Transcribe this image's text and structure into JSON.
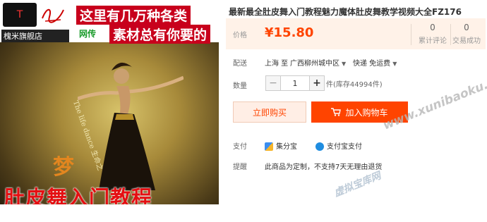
{
  "product_image": {
    "shop_logo_text": "T",
    "shop_name": "槐米旗舰店",
    "promo_line1": "这里有几万种各类",
    "promo_line2": "素材总有你要的",
    "promo_web": "网传",
    "vertical_text": "The life dance 生命之",
    "dream_char": "梦",
    "bottom_caption": "肚皮舞入门教程"
  },
  "product": {
    "title": "最新最全肚皮舞入门教程魅力魔体肚皮舞教学视频大全FZ176",
    "price_label": "价格",
    "price": "¥15.80",
    "reviews_count": "0",
    "reviews_label": "累计评论",
    "sales_count": "0",
    "sales_label": "交易成功"
  },
  "delivery": {
    "label": "配送",
    "from": "上海 至",
    "destination": "广西柳州城中区",
    "shipping": "快递 免运费"
  },
  "quantity": {
    "label": "数量",
    "value": "1",
    "minus": "−",
    "plus": "+",
    "stock": "件(库存44994件)"
  },
  "actions": {
    "buy_now": "立即购买",
    "add_to_cart": "加入购物车"
  },
  "payment": {
    "label": "支付",
    "method1": "集分宝",
    "method2": "支付宝支付"
  },
  "notice": {
    "label": "提醒",
    "text": "此商品为定制，不支持7天无理由退货"
  },
  "watermarks": {
    "w1": "www.xunibaoku.com",
    "w2": "虚拟宝库网"
  },
  "colors": {
    "accent": "#ff4400",
    "price_bg": "#fff2e8"
  }
}
